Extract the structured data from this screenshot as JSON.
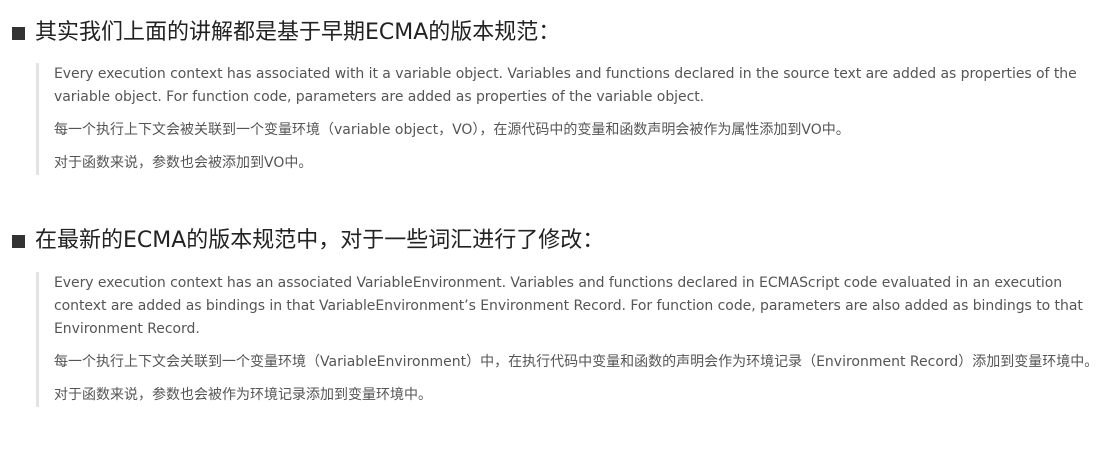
{
  "section1": {
    "heading": "其实我们上面的讲解都是基于早期ECMA的版本规范：",
    "paragraphs": [
      "Every execution context has associated with it a variable object. Variables and functions declared in the source text are added as properties of the variable object. For function code, parameters are added as properties of the variable object.",
      "每一个执行上下文会被关联到一个变量环境（variable object，VO），在源代码中的变量和函数声明会被作为属性添加到VO中。",
      "对于函数来说，参数也会被添加到VO中。"
    ]
  },
  "section2": {
    "heading": "在最新的ECMA的版本规范中，对于一些词汇进行了修改：",
    "paragraphs": [
      "Every execution context has an associated VariableEnvironment. Variables and functions declared in ECMAScript code evaluated in an execution context are added as bindings in that VariableEnvironment’s Environment Record. For function code, parameters are also added as bindings to that Environment Record.",
      "每一个执行上下文会关联到一个变量环境（VariableEnvironment）中，在执行代码中变量和函数的声明会作为环境记录（Environment Record）添加到变量环境中。",
      "对于函数来说，参数也会被作为环境记录添加到变量环境中。"
    ]
  }
}
